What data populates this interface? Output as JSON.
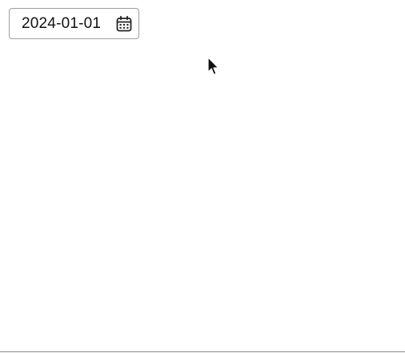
{
  "date_field": {
    "value": "2024-01-01",
    "icon": "calendar-icon"
  },
  "cursor": {
    "icon": "mouse-pointer-icon"
  }
}
